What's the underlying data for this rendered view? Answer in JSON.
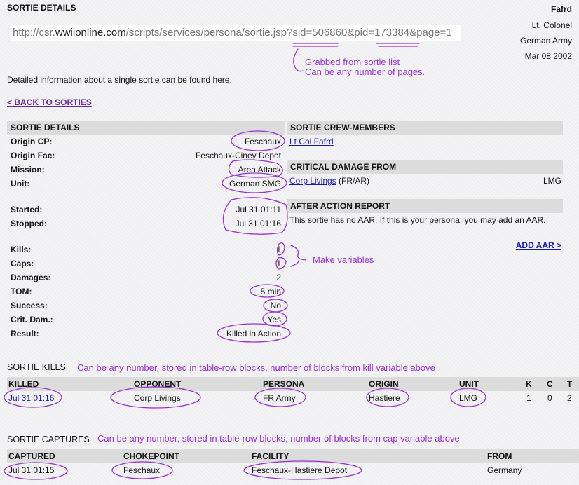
{
  "header": {
    "title": "SORTIE DETAILS",
    "user_name": "Fafrd",
    "user_rank": "Lt. Colonel",
    "user_army": "German Army",
    "user_date": "Mar 08 2002"
  },
  "url": {
    "prefix": "http://csr.",
    "domain": "wwiionline.com",
    "path": "/scripts/services/persona/sortie.jsp?sid=506860&pid=173384&page=1"
  },
  "notes": {
    "url_note_1": "Grabbed from sortie list",
    "url_note_2": "Can be any number of pages.",
    "variables_note": "Make variables",
    "kills_note": "Can be any number, stored in table-row blocks, number of blocks from kill variable above",
    "captures_note": "Can be any number, stored in table-row blocks, number of blocks from cap variable above"
  },
  "intro": "Detailed information about a single sortie can be found here.",
  "back_link": "< BACK TO SORTIES",
  "details": {
    "heading": "SORTIE DETAILS",
    "origin_cp_label": "Origin CP:",
    "origin_cp": "Feschaux",
    "origin_fac_label": "Origin Fac:",
    "origin_fac": "Feschaux-Ciney Depot",
    "mission_label": "Mission:",
    "mission": "Area Attack",
    "unit_label": "Unit:",
    "unit": "German SMG",
    "started_label": "Started:",
    "started": "Jul 31 01:11",
    "stopped_label": "Stopped:",
    "stopped": "Jul 31 01:16",
    "kills_label": "Kills:",
    "kills": "1",
    "caps_label": "Caps:",
    "caps": "1",
    "damages_label": "Damages:",
    "damages": "2",
    "tom_label": "TOM:",
    "tom": "5 min",
    "success_label": "Success:",
    "success": "No",
    "crit_label": "Crit. Dam.:",
    "crit": "Yes",
    "result_label": "Result:",
    "result": "Killed in Action"
  },
  "crew": {
    "heading": "SORTIE CREW-MEMBERS",
    "member": "Lt Col Fafrd"
  },
  "critical": {
    "heading": "CRITICAL DAMAGE FROM",
    "name": "Corp Livings",
    "suffix": " (FR/AR)",
    "weapon": "LMG"
  },
  "aar": {
    "heading": "AFTER ACTION REPORT",
    "text": "This sortie has no AAR. If this is your persona, you may add an AAR.",
    "add_link": "ADD AAR >"
  },
  "kills_table": {
    "title": "SORTIE KILLS",
    "headers": [
      "KILLED",
      "OPPONENT",
      "PERSONA",
      "ORIGIN",
      "UNIT",
      "K",
      "C",
      "T"
    ],
    "row": {
      "killed": "Jul 31 01:16",
      "opponent": "Corp Livings",
      "persona": "FR Army",
      "origin": "Hastiere",
      "unit": "LMG",
      "k": "1",
      "c": "0",
      "t": "2"
    }
  },
  "captures_table": {
    "title": "SORTIE CAPTURES",
    "headers": [
      "CAPTURED",
      "CHOKEPOINT",
      "FACILITY",
      "FROM"
    ],
    "row": {
      "captured": "Jul 31 01:15",
      "chokepoint": "Feschaux",
      "facility": "Feschaux-Hastiere Depot",
      "from": "Germany"
    }
  },
  "colors": {
    "annotation": "#9932cc",
    "link": "#1a1aa8",
    "header_bar": "#dcdcdc"
  }
}
